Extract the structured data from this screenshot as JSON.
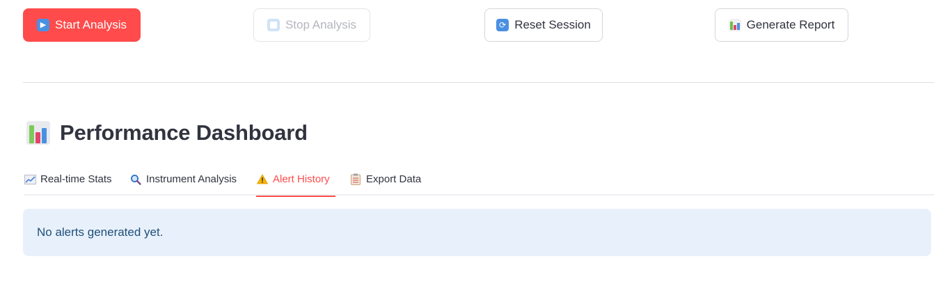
{
  "toolbar": {
    "start_label": "Start Analysis",
    "start_icon": "play-icon",
    "stop_label": "Stop Analysis",
    "stop_icon": "stop-icon",
    "reset_label": "Reset Session",
    "reset_icon": "refresh-icon",
    "report_label": "Generate Report",
    "report_icon": "bar-chart-icon"
  },
  "dashboard": {
    "title": "Performance Dashboard",
    "title_icon": "bar-chart-icon",
    "tabs": [
      {
        "label": "Real-time Stats",
        "icon": "chart-increasing-icon",
        "active": false
      },
      {
        "label": "Instrument Analysis",
        "icon": "magnifier-icon",
        "active": false
      },
      {
        "label": "Alert History",
        "icon": "warning-icon",
        "active": true
      },
      {
        "label": "Export Data",
        "icon": "clipboard-icon",
        "active": false
      }
    ],
    "info_message": "No alerts generated yet."
  },
  "colors": {
    "primary": "#ff4b4b",
    "info_bg": "#e8f1fb",
    "info_text": "#1f4e79",
    "text": "#31333f"
  }
}
